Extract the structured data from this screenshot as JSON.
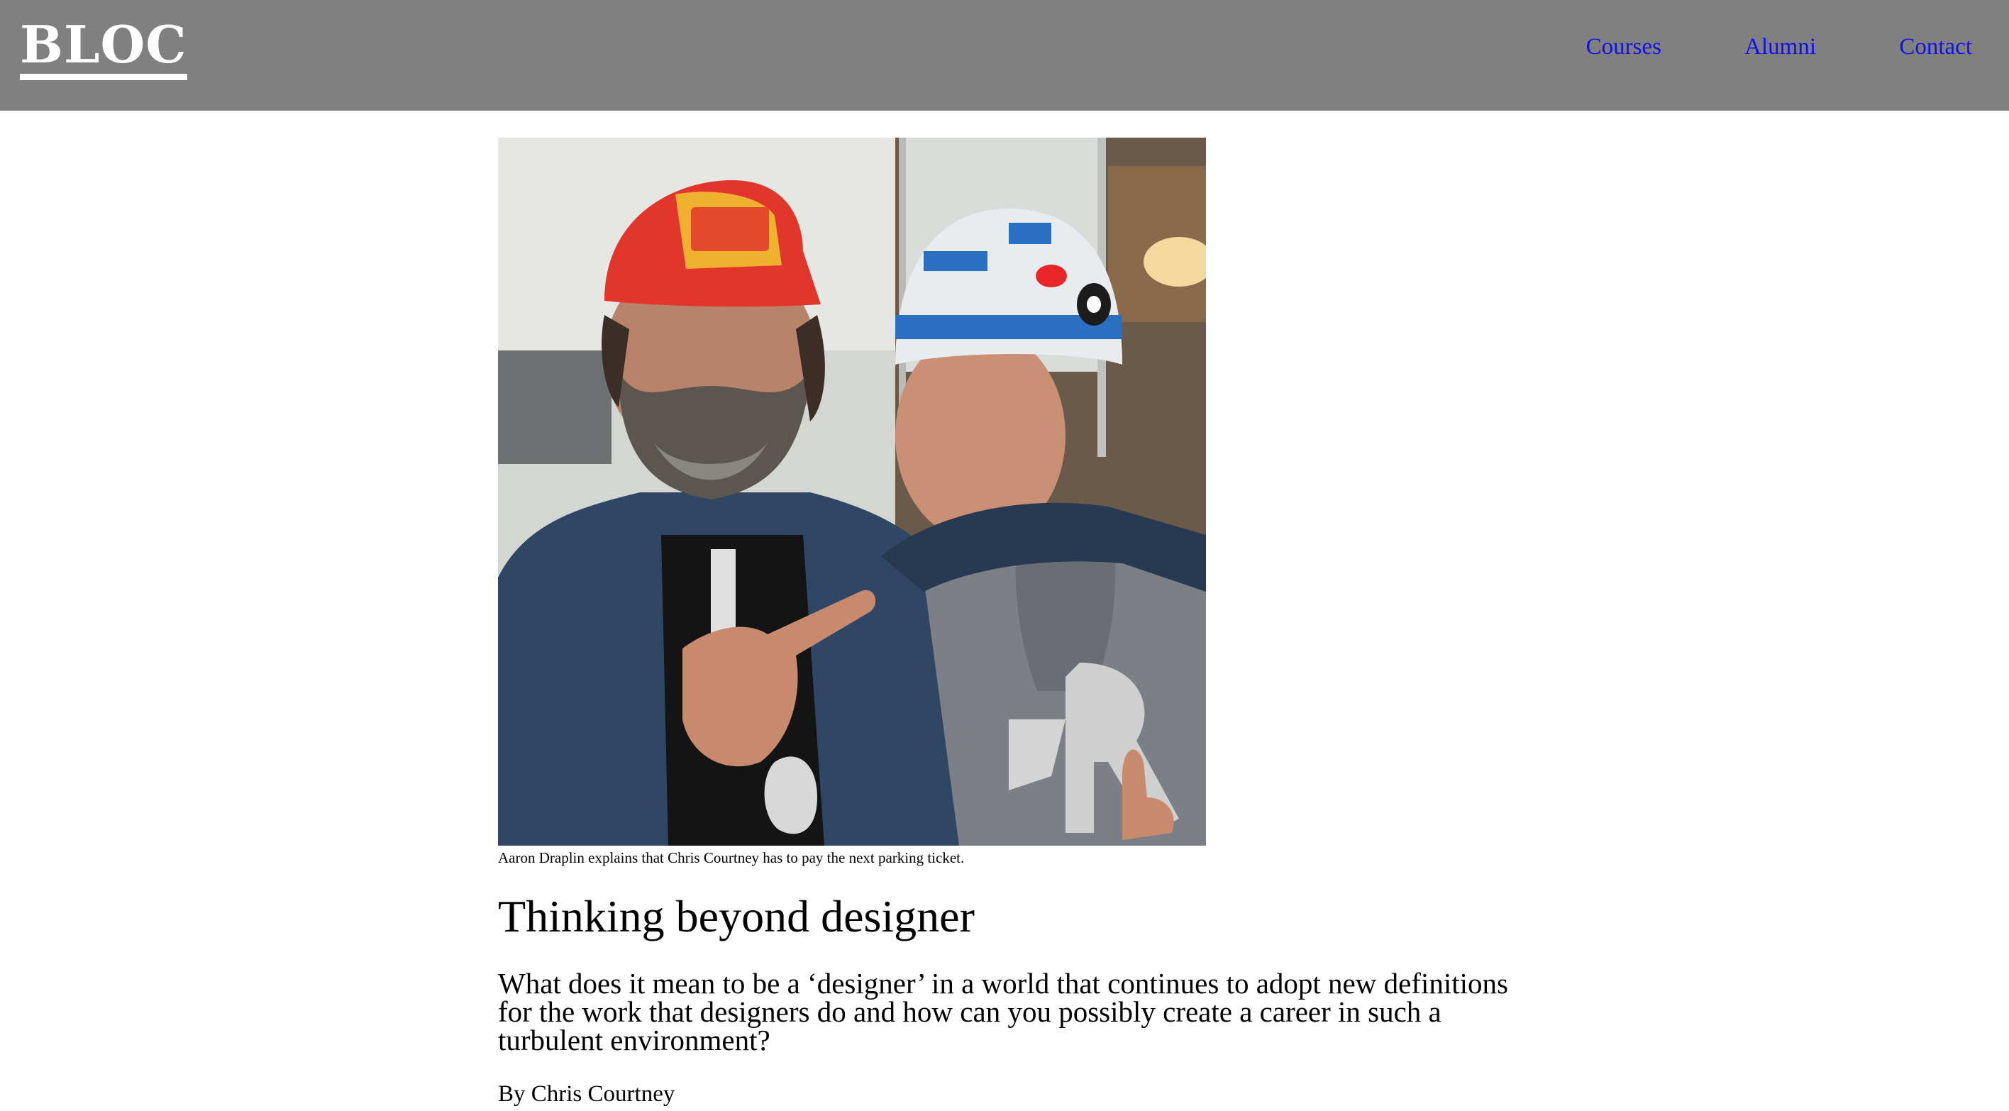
{
  "header": {
    "logo_text": "BLOC",
    "nav": [
      {
        "label": "Courses"
      },
      {
        "label": "Alumni"
      },
      {
        "label": "Contact"
      }
    ],
    "colors": {
      "background": "#808080",
      "logo": "#ffffff",
      "link": "#1010ee"
    }
  },
  "article": {
    "photo_caption": "Aaron Draplin explains that Chris Courtney has to pay the next parking ticket.",
    "headline": "Thinking beyond designer",
    "dek": "What does it mean to be a ‘designer’ in a world that continues to adopt new definitions for the work that designers do and how can you possibly create a career in such a turbulent environment?",
    "byline": "By Chris Courtney"
  }
}
